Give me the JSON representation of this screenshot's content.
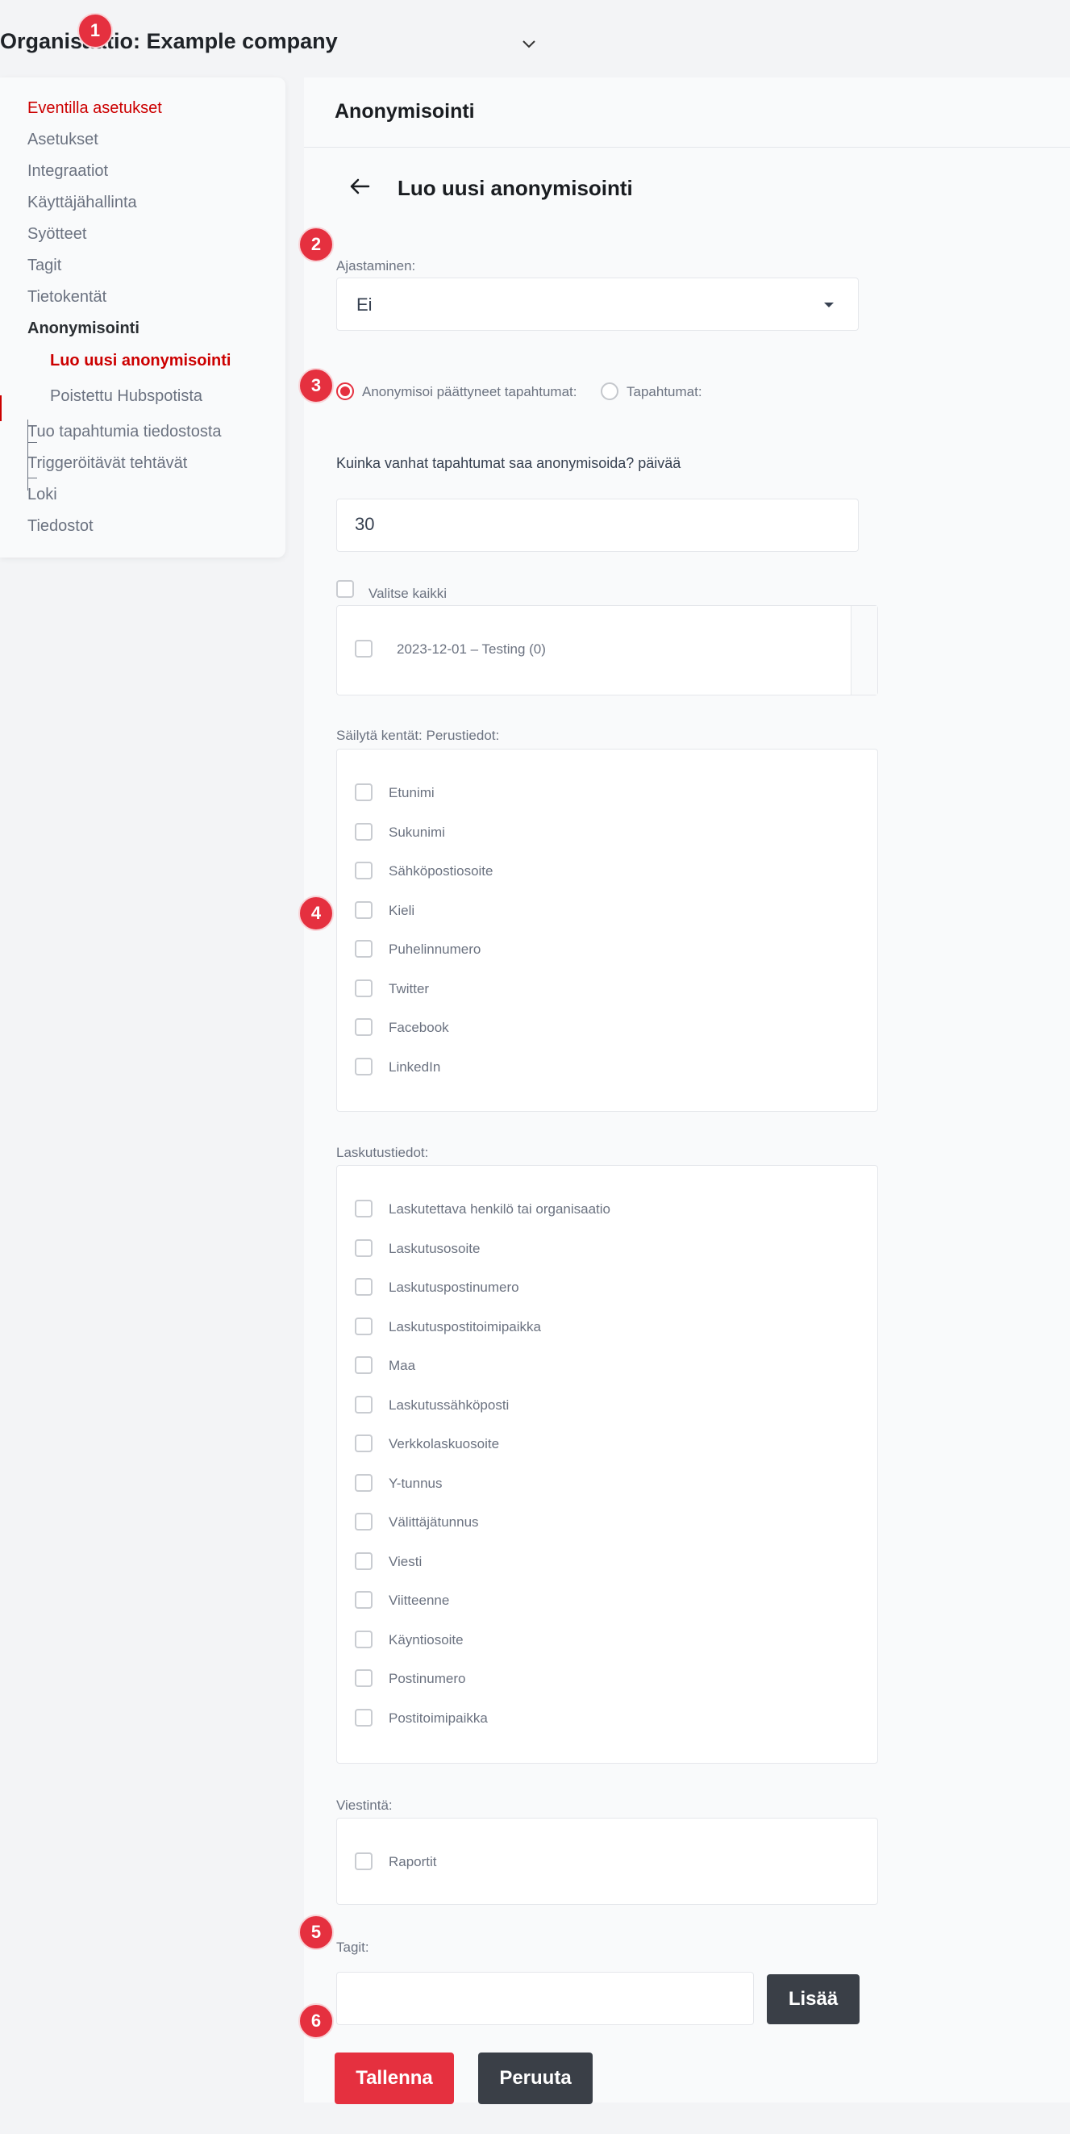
{
  "header": {
    "org_label": "Organisaatio: Example company"
  },
  "badges": [
    "1",
    "2",
    "3",
    "4",
    "5",
    "6"
  ],
  "sidebar": {
    "items": [
      {
        "label": "Eventilla asetukset"
      },
      {
        "label": "Asetukset"
      },
      {
        "label": "Integraatiot"
      },
      {
        "label": "Käyttäjähallinta"
      },
      {
        "label": "Syötteet"
      },
      {
        "label": "Tagit"
      },
      {
        "label": "Tietokentät"
      },
      {
        "label": "Anonymisointi"
      },
      {
        "label": "Tuo tapahtumia tiedostosta"
      },
      {
        "label": "Triggeröitävät tehtävät"
      },
      {
        "label": "Loki"
      },
      {
        "label": "Tiedostot"
      }
    ],
    "subitems": [
      {
        "label": "Luo uusi anonymisointi"
      },
      {
        "label": "Poistettu Hubspotista"
      }
    ]
  },
  "page": {
    "title": "Anonymisointi",
    "form_title": "Luo uusi anonymisointi"
  },
  "form": {
    "scheduling_label": "Ajastaminen:",
    "scheduling_value": "Ei",
    "radio_ended": "Anonymisoi päättyneet tapahtumat:",
    "radio_events": "Tapahtumat:",
    "days_label": "Kuinka vanhat tapahtumat saa anonymisoida? päivää",
    "days_value": "30",
    "select_all": "Valitse kaikki",
    "events": [
      {
        "label": "2023-12-01 –  Testing (0)"
      }
    ],
    "basic_label": "Säilytä kentät: Perustiedot:",
    "basic_fields": [
      {
        "label": "Etunimi"
      },
      {
        "label": "Sukunimi"
      },
      {
        "label": "Sähköpostiosoite"
      },
      {
        "label": "Kieli"
      },
      {
        "label": "Puhelinnumero"
      },
      {
        "label": "Twitter"
      },
      {
        "label": "Facebook"
      },
      {
        "label": "LinkedIn"
      }
    ],
    "billing_label": "Laskutustiedot:",
    "billing_fields": [
      {
        "label": "Laskutettava henkilö tai organisaatio"
      },
      {
        "label": "Laskutusosoite"
      },
      {
        "label": "Laskutuspostinumero"
      },
      {
        "label": "Laskutuspostitoimipaikka"
      },
      {
        "label": "Maa"
      },
      {
        "label": "Laskutussähköposti"
      },
      {
        "label": "Verkkolaskuosoite"
      },
      {
        "label": "Y-tunnus"
      },
      {
        "label": "Välittäjätunnus"
      },
      {
        "label": "Viesti"
      },
      {
        "label": "Viitteenne"
      },
      {
        "label": "Käyntiosoite"
      },
      {
        "label": "Postinumero"
      },
      {
        "label": "Postitoimipaikka"
      }
    ],
    "comm_label": "Viestintä:",
    "comm_fields": [
      {
        "label": "Raportit"
      }
    ],
    "tags_label": "Tagit:",
    "tags_value": "",
    "add_button": "Lisää",
    "save_button": "Tallenna",
    "cancel_button": "Peruuta"
  },
  "colors": {
    "accent": "#e5303f",
    "active_nav": "#cc0000",
    "dark_button": "#3a3f47"
  }
}
